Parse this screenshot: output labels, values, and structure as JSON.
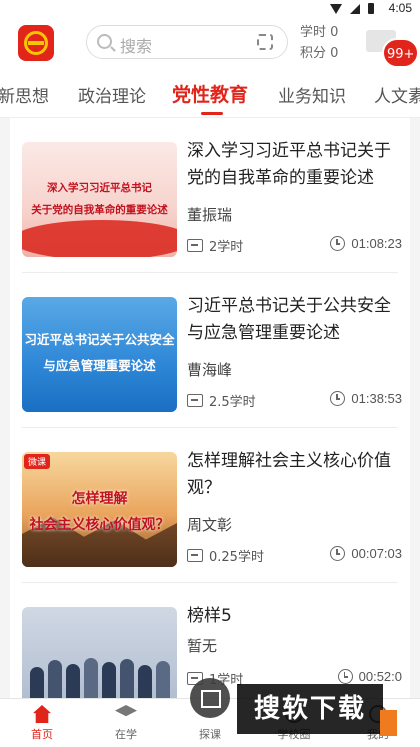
{
  "status_bar": {
    "time": "4:05"
  },
  "header": {
    "search_placeholder": "搜索",
    "study_hours_label": "学时 0",
    "points_label": "积分 0",
    "message_badge": "99+"
  },
  "tabs": [
    {
      "label": "新思想"
    },
    {
      "label": "政治理论"
    },
    {
      "label": "党性教育",
      "active": true
    },
    {
      "label": "业务知识"
    },
    {
      "label": "人文素"
    }
  ],
  "courses": [
    {
      "title": "深入学习习近平总书记关于党的自我革命的重要论述",
      "author": "董振瑞",
      "hours": "2学时",
      "duration": "01:08:23",
      "thumb_lines": [
        "深入学习习近平总书记",
        "关于党的自我革命的重要论述"
      ]
    },
    {
      "title": "习近平总书记关于公共安全与应急管理重要论述",
      "author": "曹海峰",
      "hours": "2.5学时",
      "duration": "01:38:53",
      "thumb_lines": [
        "习近平总书记关于公共安全",
        "与应急管理重要论述"
      ]
    },
    {
      "title": "怎样理解社会主义核心价值观？",
      "author": "周文彰",
      "hours": "0.25学时",
      "duration": "00:07:03",
      "thumb_tag": "微课",
      "thumb_lines": [
        "怎样理解",
        "社会主义核心价值观？"
      ]
    },
    {
      "title": "榜样5",
      "author": "暂无",
      "hours": "1学时",
      "duration": "00:52:0"
    }
  ],
  "bottom_nav": [
    {
      "label": "首页",
      "icon": "home-icon",
      "active": true
    },
    {
      "label": "在学",
      "icon": "graduation-cap-icon"
    },
    {
      "label": "探课",
      "icon": "book-icon"
    },
    {
      "label": "学校圈",
      "icon": "circle-icon"
    },
    {
      "label": "我的",
      "icon": "user-icon"
    }
  ],
  "overlay": {
    "watermark_text": "搜软下载"
  },
  "colors": {
    "accent": "#e1251b",
    "badge": "#e1251b"
  }
}
